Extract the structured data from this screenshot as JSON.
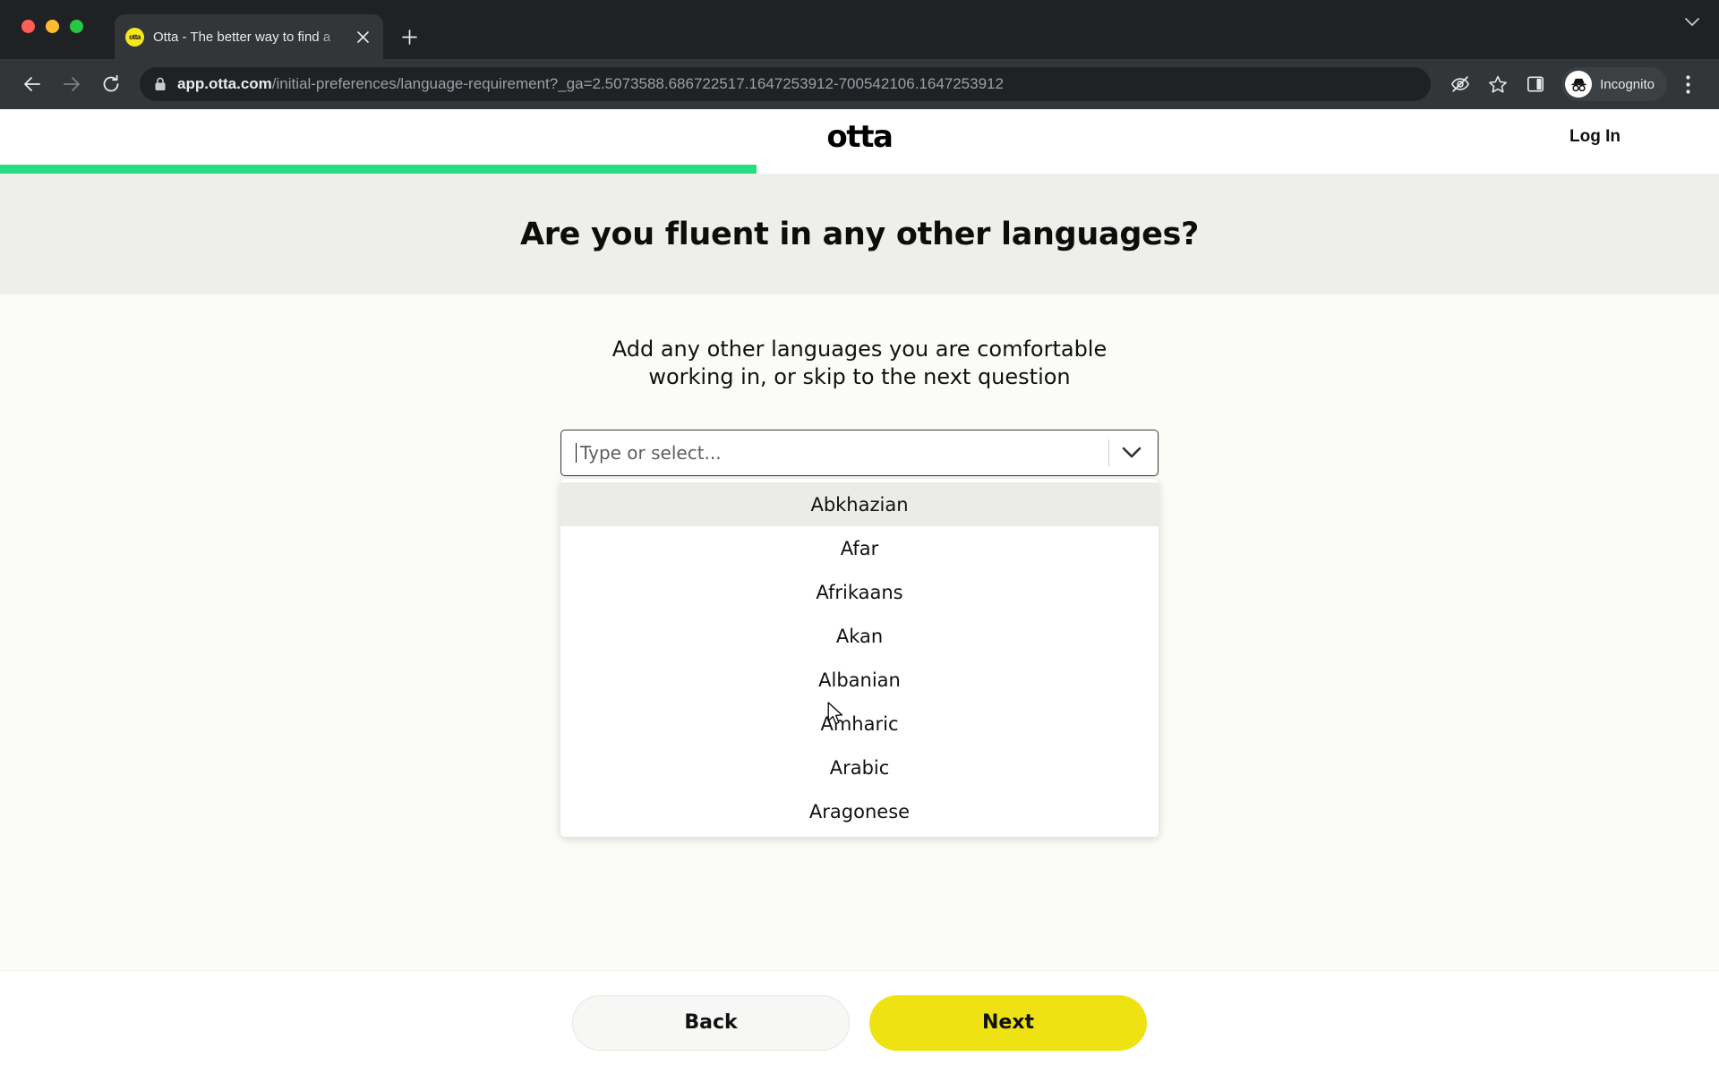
{
  "browser": {
    "tab": {
      "title": "Otta - The better way to find a",
      "favicon_label": "otta",
      "favicon_icon": "otta-favicon",
      "close_icon": "close-icon"
    },
    "new_tab_icon": "plus-icon",
    "tabstrip_chevron_icon": "chevron-down-icon",
    "back_icon": "arrow-left-icon",
    "forward_icon": "arrow-right-icon",
    "reload_icon": "reload-icon",
    "omnibox": {
      "lock_icon": "lock-icon",
      "host": "app.otta.com",
      "path": "/initial-preferences/language-requirement?_ga=2.5073588.686722517.1647253912-700542106.1647253912"
    },
    "toolbar_icons": {
      "cookies_blocked": "eye-slash-icon",
      "bookmark": "star-icon",
      "side_panel": "side-panel-icon",
      "menu": "three-dot-menu-icon",
      "incognito_avatar": "incognito-icon"
    },
    "incognito_label": "Incognito"
  },
  "page": {
    "logo": "otta",
    "login_label": "Log In",
    "progress_percent": 44,
    "progress_color": "#25de7f",
    "heading": "Are you fluent in any other languages?",
    "subtitle": "Add any other languages you are comfortable working in, or skip to the next question",
    "select": {
      "placeholder": "Type or select...",
      "value": "",
      "chevron_icon": "chevron-down-icon",
      "options": [
        "Abkhazian",
        "Afar",
        "Afrikaans",
        "Akan",
        "Albanian",
        "Amharic",
        "Arabic",
        "Aragonese"
      ],
      "highlighted_index": 0
    },
    "footer": {
      "back_label": "Back",
      "next_label": "Next",
      "next_color": "#efe212"
    }
  }
}
